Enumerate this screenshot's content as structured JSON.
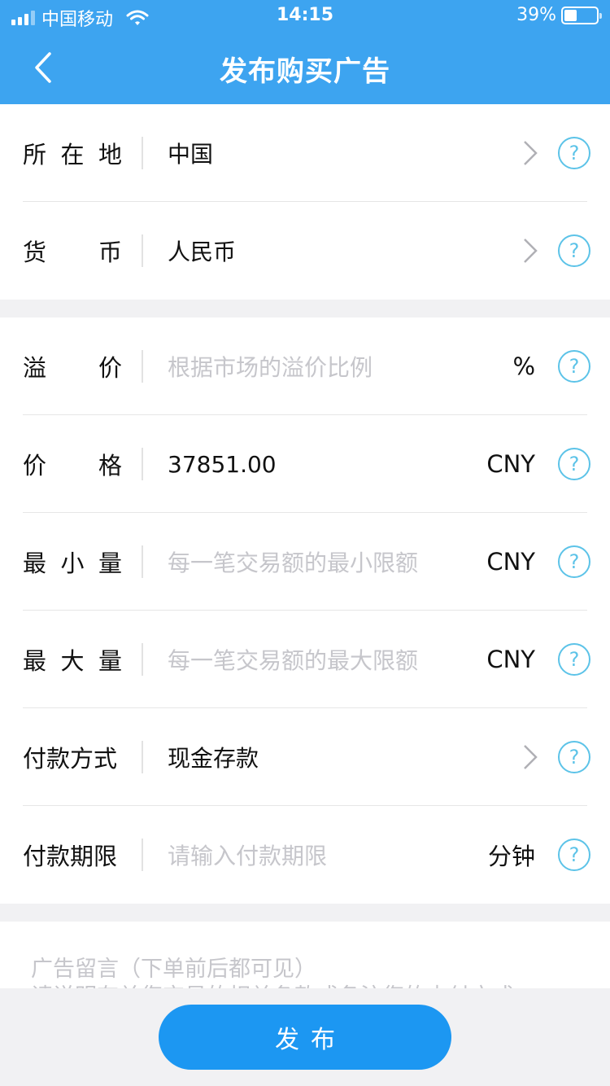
{
  "status_bar": {
    "carrier": "中国移动",
    "time": "14:15",
    "battery_percent": "39%",
    "battery_level": 0.39,
    "signal_bars": 4,
    "signal_active": 3
  },
  "header": {
    "title": "发布购买广告",
    "back_icon": "chevron-left-icon",
    "background": "#3da4f0"
  },
  "location_section": [
    {
      "label": [
        "所",
        "在",
        "地"
      ],
      "value": "中国",
      "has_chevron": true
    },
    {
      "label": [
        "货",
        "币"
      ],
      "value": "人民币",
      "has_chevron": true
    }
  ],
  "price_section": [
    {
      "label": [
        "溢",
        "价"
      ],
      "placeholder": "根据市场的溢价比例",
      "unit": "%"
    },
    {
      "label": [
        "价",
        "格"
      ],
      "value": "37851.00",
      "unit": "CNY"
    },
    {
      "label": [
        "最",
        "小",
        "量"
      ],
      "placeholder": "每一笔交易额的最小限额",
      "unit": "CNY"
    },
    {
      "label": [
        "最",
        "大",
        "量"
      ],
      "placeholder": "每一笔交易额的最大限额",
      "unit": "CNY"
    },
    {
      "label": [
        "付款方式"
      ],
      "value": "现金存款",
      "has_chevron": true
    },
    {
      "label": [
        "付款期限"
      ],
      "placeholder": "请输入付款期限",
      "unit": "分钟"
    }
  ],
  "help_icon_text": "?",
  "remark": {
    "placeholder_line1": "广告留言（下单前后都可见）",
    "placeholder_line2": "请说明有关您交易的相关条款或备注您的支付方式"
  },
  "publish_button": {
    "label": "发布",
    "color": "#1c97f2"
  }
}
